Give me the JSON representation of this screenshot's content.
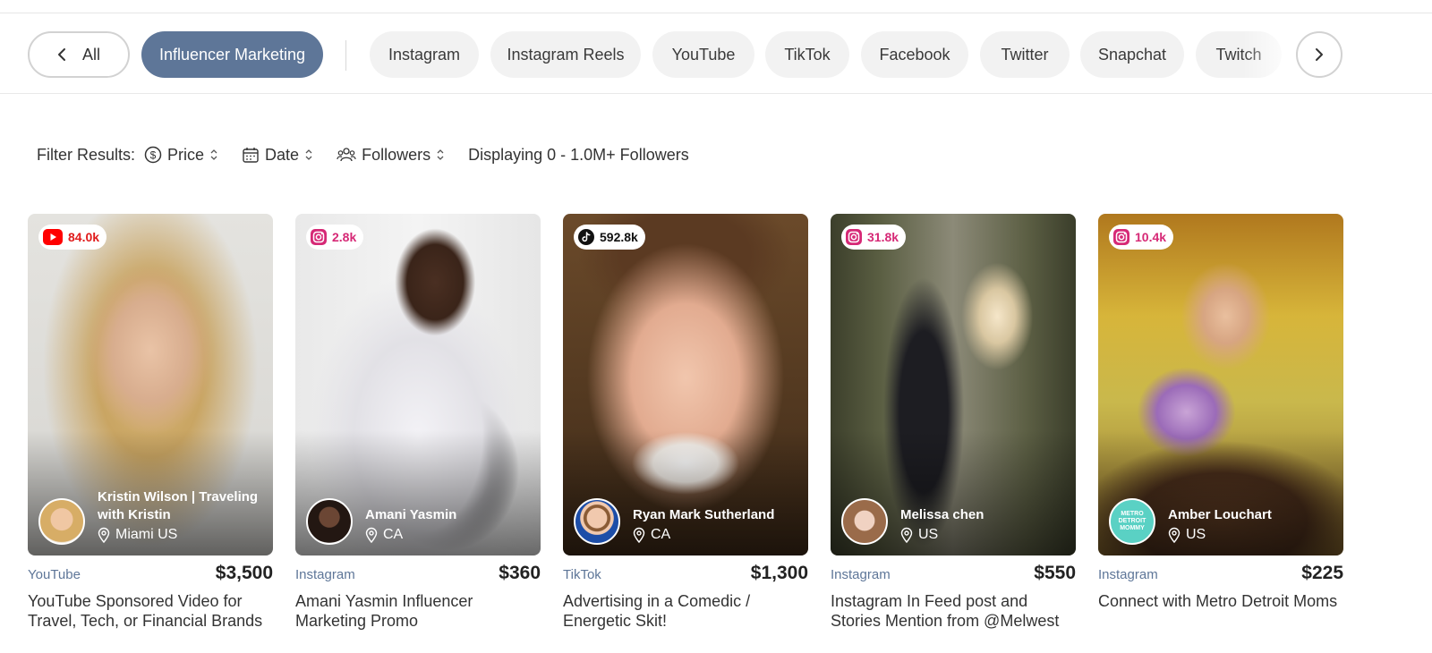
{
  "categories": {
    "all_label": "All",
    "active_label": "Influencer Marketing",
    "platforms": [
      "Instagram",
      "Instagram Reels",
      "YouTube",
      "TikTok",
      "Facebook",
      "Twitter",
      "Snapchat",
      "Twitch"
    ]
  },
  "filters": {
    "label": "Filter Results:",
    "price": "Price",
    "date": "Date",
    "followers": "Followers",
    "display_text": "Displaying 0 - 1.0M+ Followers"
  },
  "listings": [
    {
      "badge_platform": "youtube-icon",
      "followers": "84.0k",
      "creator": "Kristin Wilson | Traveling with Kristin",
      "location": "Miami US",
      "platform": "YouTube",
      "price": "$3,500",
      "title": "YouTube Sponsored Video for Travel, Tech, or Financial Brands"
    },
    {
      "badge_platform": "instagram-icon",
      "followers": "2.8k",
      "creator": "Amani Yasmin",
      "location": "CA",
      "platform": "Instagram",
      "price": "$360",
      "title": "Amani Yasmin Influencer Marketing Promo"
    },
    {
      "badge_platform": "tiktok-icon",
      "followers": "592.8k",
      "creator": "Ryan Mark Sutherland",
      "location": "CA",
      "platform": "TikTok",
      "price": "$1,300",
      "title": "Advertising in a Comedic / Energetic Skit!"
    },
    {
      "badge_platform": "instagram-icon",
      "followers": "31.8k",
      "creator": "Melissa chen",
      "location": "US",
      "platform": "Instagram",
      "price": "$550",
      "title": "Instagram In Feed post and Stories Mention from @Melwest"
    },
    {
      "badge_platform": "instagram-icon",
      "followers": "10.4k",
      "creator": "Amber Louchart",
      "location": "US",
      "platform": "Instagram",
      "price": "$225",
      "title": "Connect with Metro Detroit Moms",
      "avatar_text": "METRO DETROIT MOMMY"
    }
  ],
  "colors": {
    "accent": "#5e7698",
    "instagram": "#d62976",
    "youtube": "#ff0000",
    "tiktok": "#111111"
  }
}
